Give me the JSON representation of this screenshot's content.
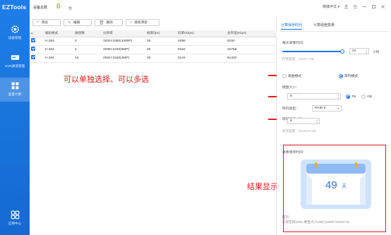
{
  "app": {
    "title": "EZTools"
  },
  "sidebar": {
    "items": [
      {
        "label": "设备管理",
        "icon": "gear-icon"
      },
      {
        "label": "NVR通道管理",
        "icon": "nvr-icon"
      },
      {
        "label": "容量计算",
        "icon": "calculator-icon"
      },
      {
        "label": "应用中心",
        "icon": "apps-grid-icon"
      }
    ]
  },
  "topbar": {
    "device_label": "设备总数",
    "device_count": "0",
    "secondary": "台",
    "lang": "简体中文",
    "menu_icon": "hamburger-menu-icon"
  },
  "toolbar": {
    "add": "添加",
    "edit": "编辑",
    "delete": "删除",
    "search_add": "搜索添加"
  },
  "table": {
    "headers": [
      "#",
      "编码格式",
      "通道数",
      "分辨率",
      "帧率(fps)",
      "码率(Kbps)",
      "总带宽(Kbps)"
    ],
    "rows": [
      {
        "checked": true,
        "codec": "H.264",
        "channels": "2",
        "resolution": "1920×1080(1080P)",
        "fps": "25",
        "bitrate": "4096",
        "bandwidth": "8192"
      },
      {
        "checked": true,
        "codec": "H.264",
        "channels": "4",
        "resolution": "4096×2160(8MP)",
        "fps": "25",
        "bitrate": "8192",
        "bandwidth": "32768"
      },
      {
        "checked": true,
        "codec": "H.264",
        "channels": "10",
        "resolution": "2592×1520(4MP)",
        "fps": "25",
        "bitrate": "6144",
        "bandwidth": "61440"
      }
    ]
  },
  "annotations": {
    "select_hint": "可以单独选择、可以多选",
    "result_label": "结果显示："
  },
  "panel": {
    "tabs": [
      "计算保存时间",
      "计算硬盘数量"
    ],
    "daily_record_label": "每天录像时间：",
    "daily_record_value": "24",
    "daily_record_unit": "小时",
    "required_capacity_hint": "所需容量：1054.7 GB",
    "mode_options": [
      "录盘模式",
      "阵列模式"
    ],
    "selected_mode_index": 1,
    "disk_size_label": "硬盘大小：",
    "disk_size_value": "8",
    "disk_unit_options": [
      "TB",
      "GB"
    ],
    "selected_unit_index": 0,
    "array_type_label": "阵列类型：",
    "array_type_value": "RAID 5",
    "array_disk_count_label": "阵列硬盘个数：",
    "array_disk_count_value": "8",
    "effective_capacity_hint": "有效容量：52153.9 GB",
    "result_section_label": "录像保存时间：",
    "result_days": "49",
    "result_days_unit": "天",
    "formula_label": "提示：",
    "formula_text": "实际空间(GB)=硬盘大小(GB)*(1000^3/1024^3)"
  },
  "colors": {
    "sidebar": "#1a73e8",
    "accent": "#1a73e8",
    "annotation": "#e01b1b",
    "count": "#f39c12"
  }
}
